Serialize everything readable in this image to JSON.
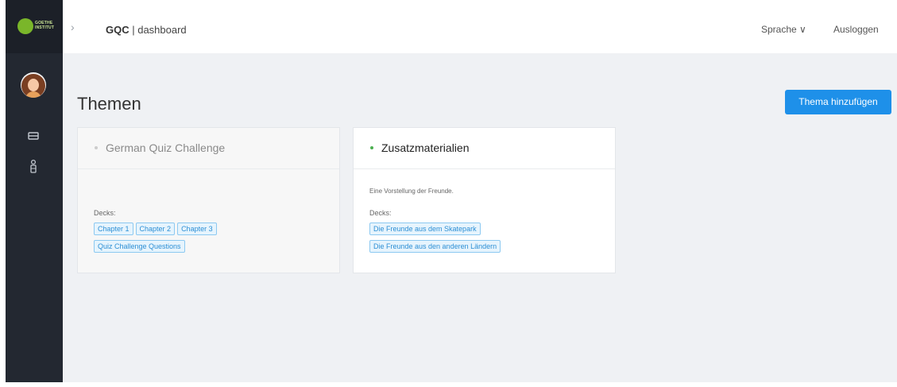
{
  "brand": {
    "logo_text": "GOETHE INSTITUT",
    "name_bold": "GQC",
    "name_rest": " | dashboard",
    "logo_color": "#7ab62a"
  },
  "topbar": {
    "language_label": "Sprache ∨",
    "logout_label": "Ausloggen"
  },
  "page": {
    "title": "Themen",
    "add_button": "Thema hinzufügen"
  },
  "topics": [
    {
      "title": "German Quiz Challenge",
      "status_color": "#cccccc",
      "description": "",
      "decks_label": "Decks:",
      "decks": [
        "Chapter 1",
        "Chapter 2",
        "Chapter 3",
        "Quiz Challenge Questions"
      ]
    },
    {
      "title": "Zusatzmaterialien",
      "status_color": "#4caf50",
      "description": "Eine Vorstellung der Freunde.",
      "decks_label": "Decks:",
      "decks": [
        "Die Freunde aus dem Skatepark",
        "Die Freunde aus den anderen Ländern"
      ]
    }
  ],
  "icons": {
    "sidebar": [
      "inbox-icon",
      "teacher-icon"
    ]
  },
  "colors": {
    "accent": "#1e90e9",
    "sidebar_bg": "#232831",
    "main_bg": "#eff1f4"
  }
}
